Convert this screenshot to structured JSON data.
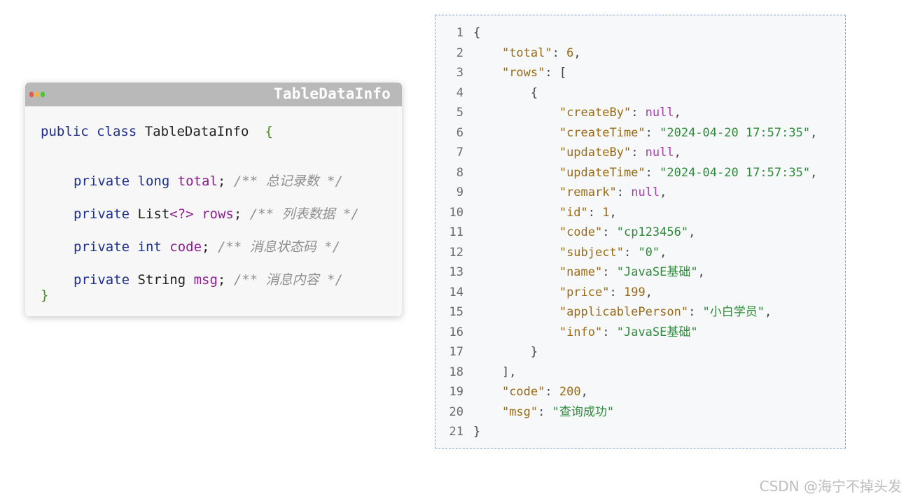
{
  "class_card": {
    "title": "TableDataInfo",
    "dot_colors": [
      "#e8574e",
      "#f3b43b",
      "#49c43f"
    ],
    "lines": [
      {
        "keyword": "public class ",
        "name": "TableDataInfo",
        "brace": "  {"
      },
      {
        "keyword": "private ",
        "type": "long ",
        "field": "total",
        "punct": "; ",
        "comment": "/** 总记录数 */"
      },
      {
        "keyword": "private ",
        "type": "List",
        "generic": "<?>",
        "space": " ",
        "field": "rows",
        "punct": "; ",
        "comment": "/** 列表数据 */"
      },
      {
        "keyword": "private ",
        "type": "int ",
        "field": "code",
        "punct": "; ",
        "comment": "/** 消息状态码 */"
      },
      {
        "keyword": "private ",
        "type": "String ",
        "field": "msg",
        "punct": "; ",
        "comment": "/** 消息内容 */"
      },
      {
        "brace": "}"
      }
    ]
  },
  "json_panel": {
    "lines": [
      {
        "num": "1",
        "tokens": [
          {
            "t": "p",
            "v": "{"
          }
        ]
      },
      {
        "num": "2",
        "tokens": [
          {
            "t": "p",
            "v": "    "
          },
          {
            "t": "k",
            "v": "\"total\""
          },
          {
            "t": "p",
            "v": ": "
          },
          {
            "t": "n",
            "v": "6"
          },
          {
            "t": "p",
            "v": ","
          }
        ]
      },
      {
        "num": "3",
        "tokens": [
          {
            "t": "p",
            "v": "    "
          },
          {
            "t": "k",
            "v": "\"rows\""
          },
          {
            "t": "p",
            "v": ": ["
          }
        ]
      },
      {
        "num": "4",
        "tokens": [
          {
            "t": "p",
            "v": "        {"
          }
        ]
      },
      {
        "num": "5",
        "tokens": [
          {
            "t": "p",
            "v": "            "
          },
          {
            "t": "k",
            "v": "\"createBy\""
          },
          {
            "t": "p",
            "v": ": "
          },
          {
            "t": "null",
            "v": "null"
          },
          {
            "t": "p",
            "v": ","
          }
        ]
      },
      {
        "num": "6",
        "tokens": [
          {
            "t": "p",
            "v": "            "
          },
          {
            "t": "k",
            "v": "\"createTime\""
          },
          {
            "t": "p",
            "v": ": "
          },
          {
            "t": "s",
            "v": "\"2024-04-20 17:57:35\""
          },
          {
            "t": "p",
            "v": ","
          }
        ]
      },
      {
        "num": "7",
        "tokens": [
          {
            "t": "p",
            "v": "            "
          },
          {
            "t": "k",
            "v": "\"updateBy\""
          },
          {
            "t": "p",
            "v": ": "
          },
          {
            "t": "null",
            "v": "null"
          },
          {
            "t": "p",
            "v": ","
          }
        ]
      },
      {
        "num": "8",
        "tokens": [
          {
            "t": "p",
            "v": "            "
          },
          {
            "t": "k",
            "v": "\"updateTime\""
          },
          {
            "t": "p",
            "v": ": "
          },
          {
            "t": "s",
            "v": "\"2024-04-20 17:57:35\""
          },
          {
            "t": "p",
            "v": ","
          }
        ]
      },
      {
        "num": "9",
        "tokens": [
          {
            "t": "p",
            "v": "            "
          },
          {
            "t": "k",
            "v": "\"remark\""
          },
          {
            "t": "p",
            "v": ": "
          },
          {
            "t": "null",
            "v": "null"
          },
          {
            "t": "p",
            "v": ","
          }
        ]
      },
      {
        "num": "10",
        "tokens": [
          {
            "t": "p",
            "v": "            "
          },
          {
            "t": "k",
            "v": "\"id\""
          },
          {
            "t": "p",
            "v": ": "
          },
          {
            "t": "n",
            "v": "1"
          },
          {
            "t": "p",
            "v": ","
          }
        ]
      },
      {
        "num": "11",
        "tokens": [
          {
            "t": "p",
            "v": "            "
          },
          {
            "t": "k",
            "v": "\"code\""
          },
          {
            "t": "p",
            "v": ": "
          },
          {
            "t": "s",
            "v": "\"cp123456\""
          },
          {
            "t": "p",
            "v": ","
          }
        ]
      },
      {
        "num": "12",
        "tokens": [
          {
            "t": "p",
            "v": "            "
          },
          {
            "t": "k",
            "v": "\"subject\""
          },
          {
            "t": "p",
            "v": ": "
          },
          {
            "t": "s",
            "v": "\"0\""
          },
          {
            "t": "p",
            "v": ","
          }
        ]
      },
      {
        "num": "13",
        "tokens": [
          {
            "t": "p",
            "v": "            "
          },
          {
            "t": "k",
            "v": "\"name\""
          },
          {
            "t": "p",
            "v": ": "
          },
          {
            "t": "s",
            "v": "\"JavaSE基础\""
          },
          {
            "t": "p",
            "v": ","
          }
        ]
      },
      {
        "num": "14",
        "tokens": [
          {
            "t": "p",
            "v": "            "
          },
          {
            "t": "k",
            "v": "\"price\""
          },
          {
            "t": "p",
            "v": ": "
          },
          {
            "t": "n",
            "v": "199"
          },
          {
            "t": "p",
            "v": ","
          }
        ]
      },
      {
        "num": "15",
        "tokens": [
          {
            "t": "p",
            "v": "            "
          },
          {
            "t": "k",
            "v": "\"applicablePerson\""
          },
          {
            "t": "p",
            "v": ": "
          },
          {
            "t": "s",
            "v": "\"小白学员\""
          },
          {
            "t": "p",
            "v": ","
          }
        ]
      },
      {
        "num": "16",
        "tokens": [
          {
            "t": "p",
            "v": "            "
          },
          {
            "t": "k",
            "v": "\"info\""
          },
          {
            "t": "p",
            "v": ": "
          },
          {
            "t": "s",
            "v": "\"JavaSE基础\""
          }
        ]
      },
      {
        "num": "17",
        "tokens": [
          {
            "t": "p",
            "v": "        }"
          }
        ]
      },
      {
        "num": "18",
        "tokens": [
          {
            "t": "p",
            "v": "    ],"
          }
        ]
      },
      {
        "num": "19",
        "tokens": [
          {
            "t": "p",
            "v": "    "
          },
          {
            "t": "k",
            "v": "\"code\""
          },
          {
            "t": "p",
            "v": ": "
          },
          {
            "t": "n",
            "v": "200"
          },
          {
            "t": "p",
            "v": ","
          }
        ]
      },
      {
        "num": "20",
        "tokens": [
          {
            "t": "p",
            "v": "    "
          },
          {
            "t": "k",
            "v": "\"msg\""
          },
          {
            "t": "p",
            "v": ": "
          },
          {
            "t": "s",
            "v": "\"查询成功\""
          }
        ]
      },
      {
        "num": "21",
        "tokens": [
          {
            "t": "p",
            "v": "}"
          }
        ]
      }
    ]
  },
  "watermark": "CSDN @海宁不掉头发"
}
